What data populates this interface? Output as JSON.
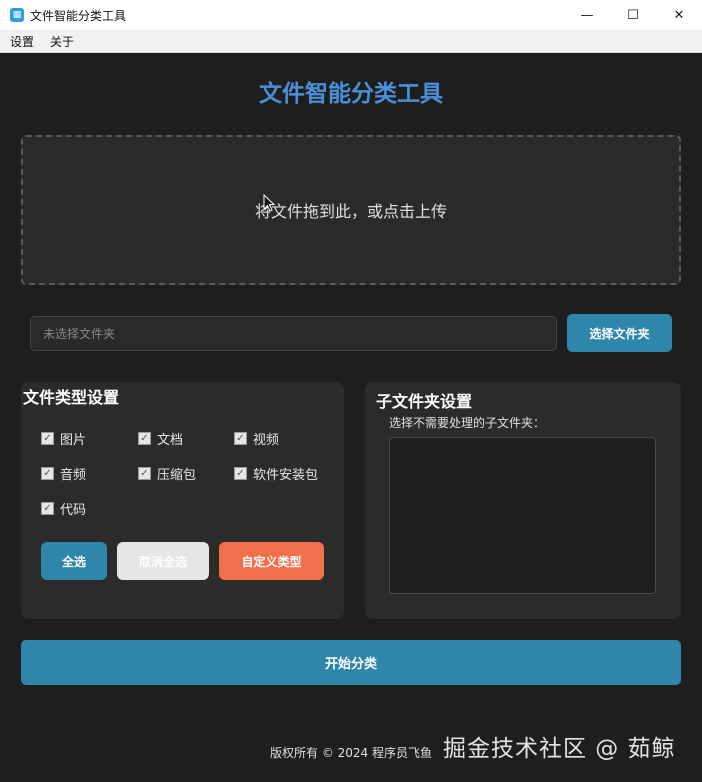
{
  "window": {
    "title": "文件智能分类工具",
    "controls": {
      "minimize": "—",
      "maximize": "☐",
      "close": "✕"
    },
    "app_icon_glyph": "🗂"
  },
  "menu": {
    "items": [
      "设置",
      "关于"
    ]
  },
  "app_title": "文件智能分类工具",
  "dropzone": {
    "text": "将文件拖到此，或点击上传"
  },
  "folder": {
    "placeholder": "未选择文件夹",
    "button_label": "选择文件夹"
  },
  "file_types": {
    "title": "文件类型设置",
    "options": [
      {
        "label": "图片",
        "checked": true
      },
      {
        "label": "文档",
        "checked": true
      },
      {
        "label": "视频",
        "checked": true
      },
      {
        "label": "音频",
        "checked": true
      },
      {
        "label": "压缩包",
        "checked": true
      },
      {
        "label": "软件安装包",
        "checked": true
      },
      {
        "label": "代码",
        "checked": true
      }
    ],
    "buttons": {
      "select_all": "全选",
      "deselect_all": "取消全选",
      "custom_type": "自定义类型"
    }
  },
  "subfolders": {
    "title": "子文件夹设置",
    "hint": "选择不需要处理的子文件夹："
  },
  "start_button": "开始分类",
  "footer": "版权所有 © 2024 程序员飞鱼",
  "watermark": "掘金技术社区 @ 茹鲸",
  "colors": {
    "accent": "#2e86ab",
    "title_blue": "#4a90d9",
    "custom_orange": "#f26f4b",
    "background": "#1e1e1e"
  }
}
